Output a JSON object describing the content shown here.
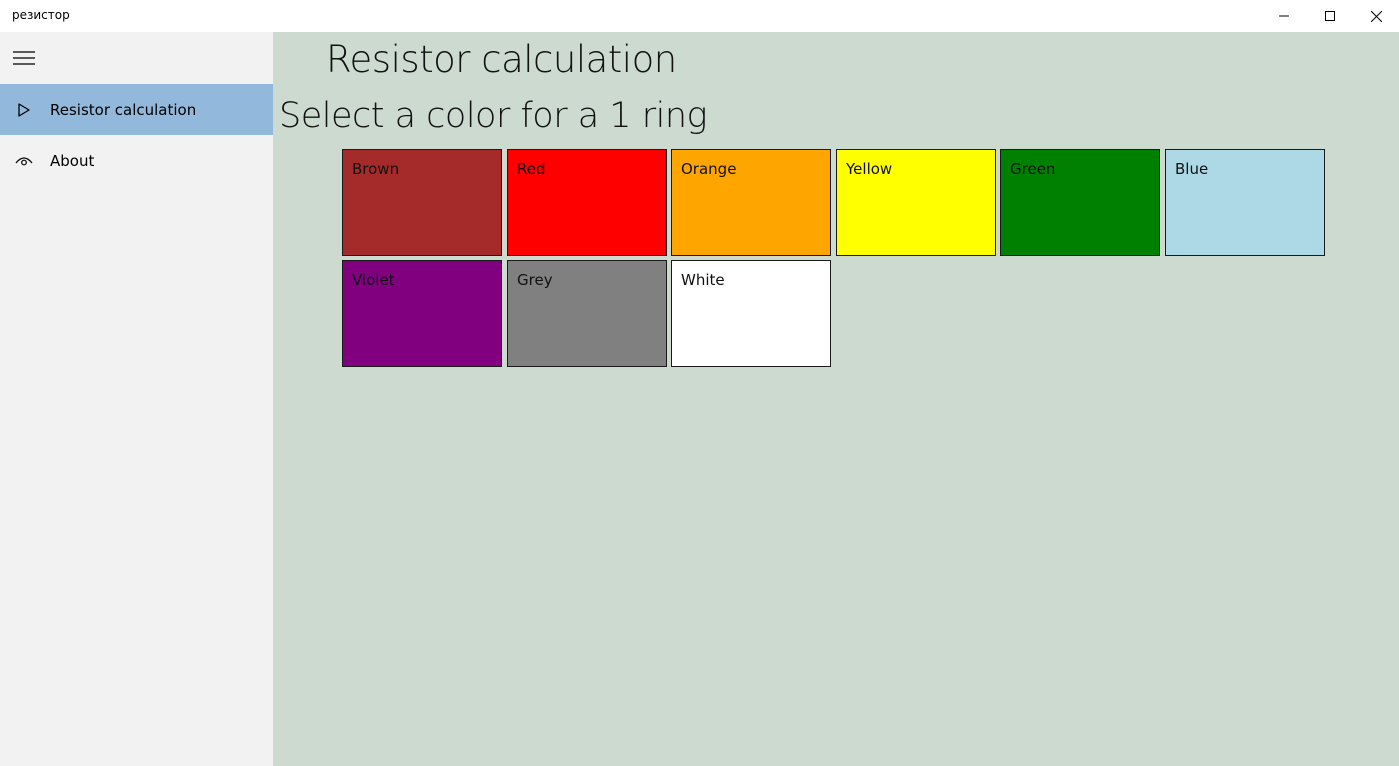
{
  "window": {
    "title": "резистор",
    "icons": {
      "minimize": "minimize-icon",
      "maximize": "maximize-icon",
      "close": "close-icon"
    }
  },
  "sidebar": {
    "menu_icon": "hamburger-icon",
    "items": [
      {
        "label": "Resistor calculation",
        "icon": "play-triangle-icon",
        "selected": true
      },
      {
        "label": "About",
        "icon": "eye-icon",
        "selected": false
      }
    ]
  },
  "main": {
    "page_title": "Resistor calculation",
    "prompt": "Select a color for a 1 ring",
    "colors": [
      {
        "label": "Brown",
        "color": "#a52a2a"
      },
      {
        "label": "Red",
        "color": "#ff0000"
      },
      {
        "label": "Orange",
        "color": "#ffa500"
      },
      {
        "label": "Yellow",
        "color": "#ffff00"
      },
      {
        "label": "Green",
        "color": "#008000"
      },
      {
        "label": "Blue",
        "color": "#add8e6"
      },
      {
        "label": "Violet",
        "color": "#800080"
      },
      {
        "label": "Grey",
        "color": "#808080"
      },
      {
        "label": "White",
        "color": "#ffffff"
      }
    ]
  },
  "theme": {
    "sidebar_bg": "#f2f2f2",
    "selected_bg": "#92b9db",
    "content_bg": "#ccdad0"
  }
}
